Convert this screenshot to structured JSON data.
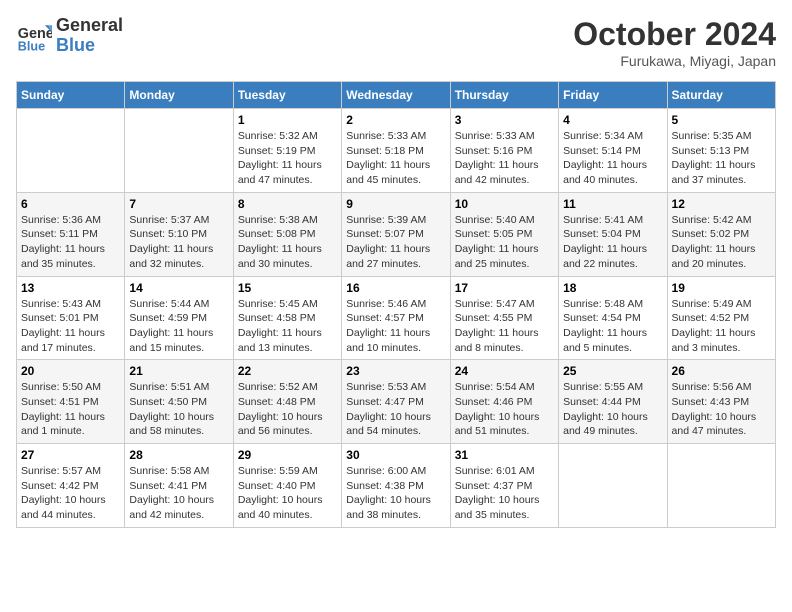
{
  "header": {
    "logo_line1": "General",
    "logo_line2": "Blue",
    "title": "October 2024",
    "location": "Furukawa, Miyagi, Japan"
  },
  "weekdays": [
    "Sunday",
    "Monday",
    "Tuesday",
    "Wednesday",
    "Thursday",
    "Friday",
    "Saturday"
  ],
  "weeks": [
    [
      {
        "day": "",
        "sunrise": "",
        "sunset": "",
        "daylight": ""
      },
      {
        "day": "",
        "sunrise": "",
        "sunset": "",
        "daylight": ""
      },
      {
        "day": "1",
        "sunrise": "Sunrise: 5:32 AM",
        "sunset": "Sunset: 5:19 PM",
        "daylight": "Daylight: 11 hours and 47 minutes."
      },
      {
        "day": "2",
        "sunrise": "Sunrise: 5:33 AM",
        "sunset": "Sunset: 5:18 PM",
        "daylight": "Daylight: 11 hours and 45 minutes."
      },
      {
        "day": "3",
        "sunrise": "Sunrise: 5:33 AM",
        "sunset": "Sunset: 5:16 PM",
        "daylight": "Daylight: 11 hours and 42 minutes."
      },
      {
        "day": "4",
        "sunrise": "Sunrise: 5:34 AM",
        "sunset": "Sunset: 5:14 PM",
        "daylight": "Daylight: 11 hours and 40 minutes."
      },
      {
        "day": "5",
        "sunrise": "Sunrise: 5:35 AM",
        "sunset": "Sunset: 5:13 PM",
        "daylight": "Daylight: 11 hours and 37 minutes."
      }
    ],
    [
      {
        "day": "6",
        "sunrise": "Sunrise: 5:36 AM",
        "sunset": "Sunset: 5:11 PM",
        "daylight": "Daylight: 11 hours and 35 minutes."
      },
      {
        "day": "7",
        "sunrise": "Sunrise: 5:37 AM",
        "sunset": "Sunset: 5:10 PM",
        "daylight": "Daylight: 11 hours and 32 minutes."
      },
      {
        "day": "8",
        "sunrise": "Sunrise: 5:38 AM",
        "sunset": "Sunset: 5:08 PM",
        "daylight": "Daylight: 11 hours and 30 minutes."
      },
      {
        "day": "9",
        "sunrise": "Sunrise: 5:39 AM",
        "sunset": "Sunset: 5:07 PM",
        "daylight": "Daylight: 11 hours and 27 minutes."
      },
      {
        "day": "10",
        "sunrise": "Sunrise: 5:40 AM",
        "sunset": "Sunset: 5:05 PM",
        "daylight": "Daylight: 11 hours and 25 minutes."
      },
      {
        "day": "11",
        "sunrise": "Sunrise: 5:41 AM",
        "sunset": "Sunset: 5:04 PM",
        "daylight": "Daylight: 11 hours and 22 minutes."
      },
      {
        "day": "12",
        "sunrise": "Sunrise: 5:42 AM",
        "sunset": "Sunset: 5:02 PM",
        "daylight": "Daylight: 11 hours and 20 minutes."
      }
    ],
    [
      {
        "day": "13",
        "sunrise": "Sunrise: 5:43 AM",
        "sunset": "Sunset: 5:01 PM",
        "daylight": "Daylight: 11 hours and 17 minutes."
      },
      {
        "day": "14",
        "sunrise": "Sunrise: 5:44 AM",
        "sunset": "Sunset: 4:59 PM",
        "daylight": "Daylight: 11 hours and 15 minutes."
      },
      {
        "day": "15",
        "sunrise": "Sunrise: 5:45 AM",
        "sunset": "Sunset: 4:58 PM",
        "daylight": "Daylight: 11 hours and 13 minutes."
      },
      {
        "day": "16",
        "sunrise": "Sunrise: 5:46 AM",
        "sunset": "Sunset: 4:57 PM",
        "daylight": "Daylight: 11 hours and 10 minutes."
      },
      {
        "day": "17",
        "sunrise": "Sunrise: 5:47 AM",
        "sunset": "Sunset: 4:55 PM",
        "daylight": "Daylight: 11 hours and 8 minutes."
      },
      {
        "day": "18",
        "sunrise": "Sunrise: 5:48 AM",
        "sunset": "Sunset: 4:54 PM",
        "daylight": "Daylight: 11 hours and 5 minutes."
      },
      {
        "day": "19",
        "sunrise": "Sunrise: 5:49 AM",
        "sunset": "Sunset: 4:52 PM",
        "daylight": "Daylight: 11 hours and 3 minutes."
      }
    ],
    [
      {
        "day": "20",
        "sunrise": "Sunrise: 5:50 AM",
        "sunset": "Sunset: 4:51 PM",
        "daylight": "Daylight: 11 hours and 1 minute."
      },
      {
        "day": "21",
        "sunrise": "Sunrise: 5:51 AM",
        "sunset": "Sunset: 4:50 PM",
        "daylight": "Daylight: 10 hours and 58 minutes."
      },
      {
        "day": "22",
        "sunrise": "Sunrise: 5:52 AM",
        "sunset": "Sunset: 4:48 PM",
        "daylight": "Daylight: 10 hours and 56 minutes."
      },
      {
        "day": "23",
        "sunrise": "Sunrise: 5:53 AM",
        "sunset": "Sunset: 4:47 PM",
        "daylight": "Daylight: 10 hours and 54 minutes."
      },
      {
        "day": "24",
        "sunrise": "Sunrise: 5:54 AM",
        "sunset": "Sunset: 4:46 PM",
        "daylight": "Daylight: 10 hours and 51 minutes."
      },
      {
        "day": "25",
        "sunrise": "Sunrise: 5:55 AM",
        "sunset": "Sunset: 4:44 PM",
        "daylight": "Daylight: 10 hours and 49 minutes."
      },
      {
        "day": "26",
        "sunrise": "Sunrise: 5:56 AM",
        "sunset": "Sunset: 4:43 PM",
        "daylight": "Daylight: 10 hours and 47 minutes."
      }
    ],
    [
      {
        "day": "27",
        "sunrise": "Sunrise: 5:57 AM",
        "sunset": "Sunset: 4:42 PM",
        "daylight": "Daylight: 10 hours and 44 minutes."
      },
      {
        "day": "28",
        "sunrise": "Sunrise: 5:58 AM",
        "sunset": "Sunset: 4:41 PM",
        "daylight": "Daylight: 10 hours and 42 minutes."
      },
      {
        "day": "29",
        "sunrise": "Sunrise: 5:59 AM",
        "sunset": "Sunset: 4:40 PM",
        "daylight": "Daylight: 10 hours and 40 minutes."
      },
      {
        "day": "30",
        "sunrise": "Sunrise: 6:00 AM",
        "sunset": "Sunset: 4:38 PM",
        "daylight": "Daylight: 10 hours and 38 minutes."
      },
      {
        "day": "31",
        "sunrise": "Sunrise: 6:01 AM",
        "sunset": "Sunset: 4:37 PM",
        "daylight": "Daylight: 10 hours and 35 minutes."
      },
      {
        "day": "",
        "sunrise": "",
        "sunset": "",
        "daylight": ""
      },
      {
        "day": "",
        "sunrise": "",
        "sunset": "",
        "daylight": ""
      }
    ]
  ]
}
